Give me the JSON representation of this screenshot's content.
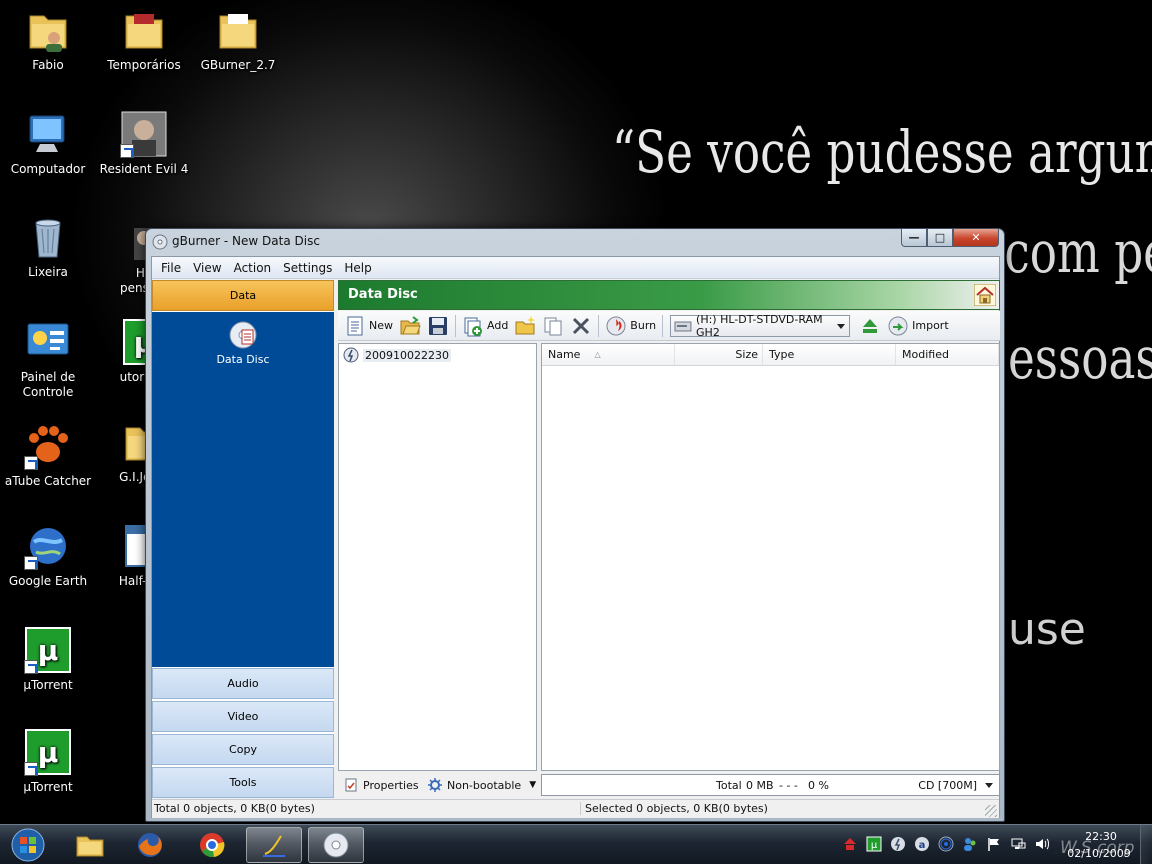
{
  "desktop": {
    "quote_lines": [
      "“Se você pudesse argumentar",
      "racionalmente com pessoas",
      "essoas",
      "use"
    ],
    "icons": [
      {
        "label": "Fabio"
      },
      {
        "label": "Temporários"
      },
      {
        "label": "GBurner_2.7"
      },
      {
        "label": "Computador"
      },
      {
        "label": "Resident Evil 4"
      },
      {
        "label": "Lixeira"
      },
      {
        "label": "Ho\npensam"
      },
      {
        "label": "Painel de\nControle"
      },
      {
        "label": "utorrent"
      },
      {
        "label": "aTube Catcher"
      },
      {
        "label": "G.I.Joe.T"
      },
      {
        "label": "Google Earth"
      },
      {
        "label": "Half-ope"
      },
      {
        "label": "µTorrent"
      },
      {
        "label": "µTorrent"
      }
    ]
  },
  "window": {
    "title": "gBurner - New Data Disc",
    "menu": [
      "File",
      "View",
      "Action",
      "Settings",
      "Help"
    ],
    "nav": {
      "active": "Data",
      "panel_item": "Data Disc",
      "categories": [
        "Audio",
        "Video",
        "Copy",
        "Tools"
      ]
    },
    "header_title": "Data Disc",
    "toolbar": {
      "new_label": "New",
      "add_label": "Add",
      "burn_label": "Burn",
      "drive": "(H:) HL-DT-STDVD-RAM GH2",
      "import_label": "Import"
    },
    "tree": {
      "root": "200910022230"
    },
    "columns": {
      "name": "Name",
      "size": "Size",
      "type": "Type",
      "modified": "Modified"
    },
    "bottom": {
      "properties_label": "Properties",
      "boot_label": "Non-bootable",
      "total_label": "Total",
      "total_size": "0 MB",
      "dashes": "- - -",
      "percent": "0 %",
      "media": "CD [700M]"
    },
    "status": {
      "left": "Total 0 objects, 0 KB(0 bytes)",
      "right": "Selected 0 objects, 0 KB(0 bytes)"
    }
  },
  "taskbar": {
    "clock_time": "22:30",
    "clock_date": "02/10/2009",
    "watermark": "W.S.corp"
  }
}
